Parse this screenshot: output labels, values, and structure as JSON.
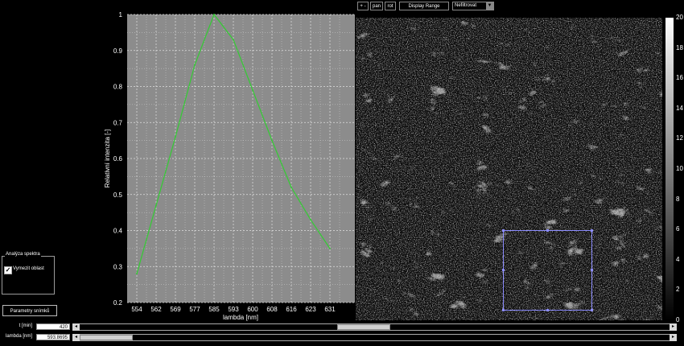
{
  "toolbar": {
    "zoom_label": "+ -",
    "pan_label": "pan",
    "rot_label": "rot",
    "display_range_label": "Display Range",
    "filter_select_value": "Nefiltrovat"
  },
  "left_panel": {
    "group_title": "Analýza spektra",
    "checkbox_label": "Vymezit oblast",
    "checkbox_checked": true,
    "params_button_label": "Parametry snímků"
  },
  "sliders": {
    "time_label": "t [min]",
    "time_value": "420",
    "lambda_label": "lambda [nm]",
    "lambda_value": "593.8695",
    "time_position": 0.48,
    "lambda_position": 0.0
  },
  "colorbar": {
    "ticks": [
      "20",
      "18",
      "16",
      "14",
      "12",
      "10",
      "8",
      "6",
      "4",
      "2",
      "0"
    ]
  },
  "chart_data": {
    "type": "line",
    "xlabel": "lambda [nm]",
    "ylabel": "Relativní intenzita [-]",
    "categories": [
      "554",
      "562",
      "569",
      "577",
      "585",
      "593",
      "600",
      "608",
      "616",
      "623",
      "631"
    ],
    "series": [
      {
        "values": [
          0.28,
          0.47,
          0.66,
          0.86,
          1.0,
          0.93,
          0.79,
          0.65,
          0.52,
          0.43,
          0.35
        ]
      }
    ],
    "ylim": [
      0.2,
      1.0
    ],
    "yticks": [
      0.2,
      0.3,
      0.4,
      0.5,
      0.6,
      0.7,
      0.8,
      0.9,
      1
    ],
    "grid": true,
    "line_color": "#33cc33",
    "background": "#8c8c8c"
  }
}
